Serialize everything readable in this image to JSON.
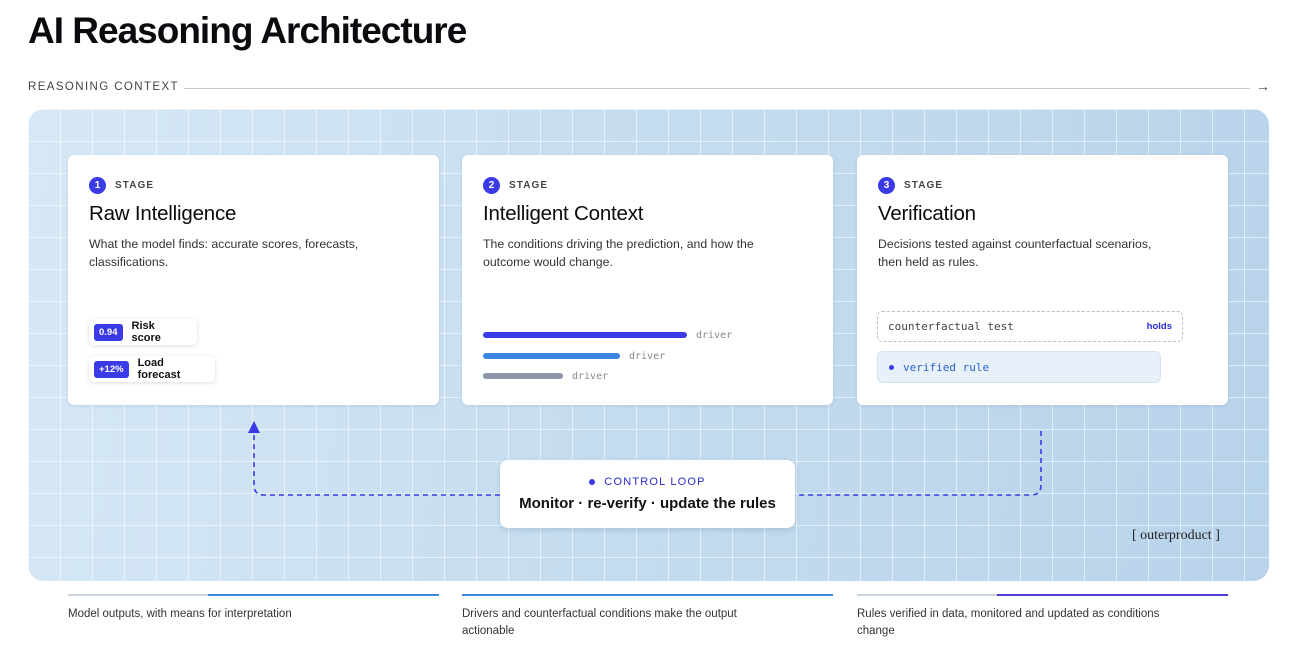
{
  "title": "AI Reasoning Architecture",
  "context": {
    "label": "REASONING CONTEXT",
    "arrow": "→"
  },
  "stages": [
    {
      "num": "1",
      "label": "STAGE",
      "title": "Raw Intelligence",
      "description": "What the model finds: accurate scores, forecasts, classifications.",
      "chips": [
        {
          "value": "0.94",
          "label": "Risk score"
        },
        {
          "value": "+12%",
          "label": "Load forecast"
        }
      ]
    },
    {
      "num": "2",
      "label": "STAGE",
      "title": "Intelligent Context",
      "description": "The conditions driving the prediction, and how the outcome would change.",
      "drivers": [
        {
          "label": "driver",
          "weight": 1.0,
          "color": "#3a3ae6"
        },
        {
          "label": "driver",
          "weight": 0.67,
          "color": "#3b86e0"
        },
        {
          "label": "driver",
          "weight": 0.39,
          "color": "#8b97a6"
        }
      ]
    },
    {
      "num": "3",
      "label": "STAGE",
      "title": "Verification",
      "description": "Decisions tested against counterfactual scenarios, then held as rules.",
      "counterfactual": {
        "text": "counterfactual test",
        "status": "holds"
      },
      "verified": {
        "text": "verified rule"
      }
    }
  ],
  "control_loop": {
    "label": "CONTROL LOOP",
    "text": "Monitor · re-verify · update the rules"
  },
  "brand": "[ outerproduct ]",
  "footer": [
    {
      "text": "Model outputs, with means for interpretation",
      "fill_color": "#3b86e0"
    },
    {
      "text": "Drivers and counterfactual conditions make the output actionable",
      "fill_color": "#3b86e0"
    },
    {
      "text": "Rules verified in data, monitored and updated as conditions change",
      "fill_color": "#4a3fd8"
    }
  ],
  "colors": {
    "accent": "#3a3ae6",
    "loop_line": "#3a3ae6"
  }
}
